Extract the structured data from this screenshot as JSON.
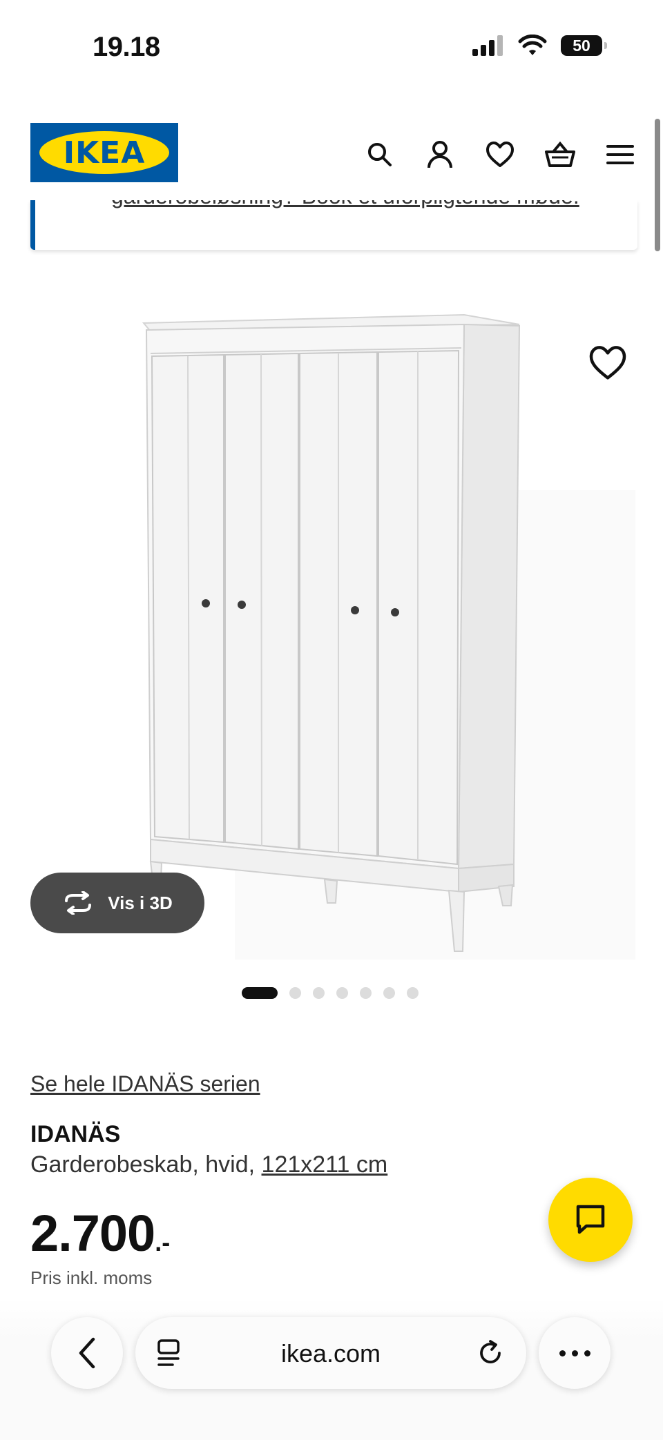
{
  "status_bar": {
    "time": "19.18",
    "battery": "50"
  },
  "header": {
    "logo_text": "IKEA",
    "icons": [
      "search-icon",
      "account-icon",
      "heart-icon",
      "basket-icon",
      "menu-icon"
    ]
  },
  "banner": {
    "text": "garderobeløsning? Book et uforpligtende møde."
  },
  "product": {
    "view_3d_label": "Vis i 3D",
    "carousel_count": 7,
    "carousel_active": 1,
    "series_link": "Se hele IDANÄS serien",
    "name": "IDANÄS",
    "description": "Garderobeskab, hvid,",
    "size_link": "121x211 cm",
    "price": "2.700",
    "price_suffix": ".-",
    "vat_note": "Pris inkl. moms"
  },
  "browser": {
    "url": "ikea.com"
  },
  "colors": {
    "ikea_blue": "#0058a3",
    "ikea_yellow": "#ffdb00",
    "pill_dark": "#4a4a4a"
  }
}
